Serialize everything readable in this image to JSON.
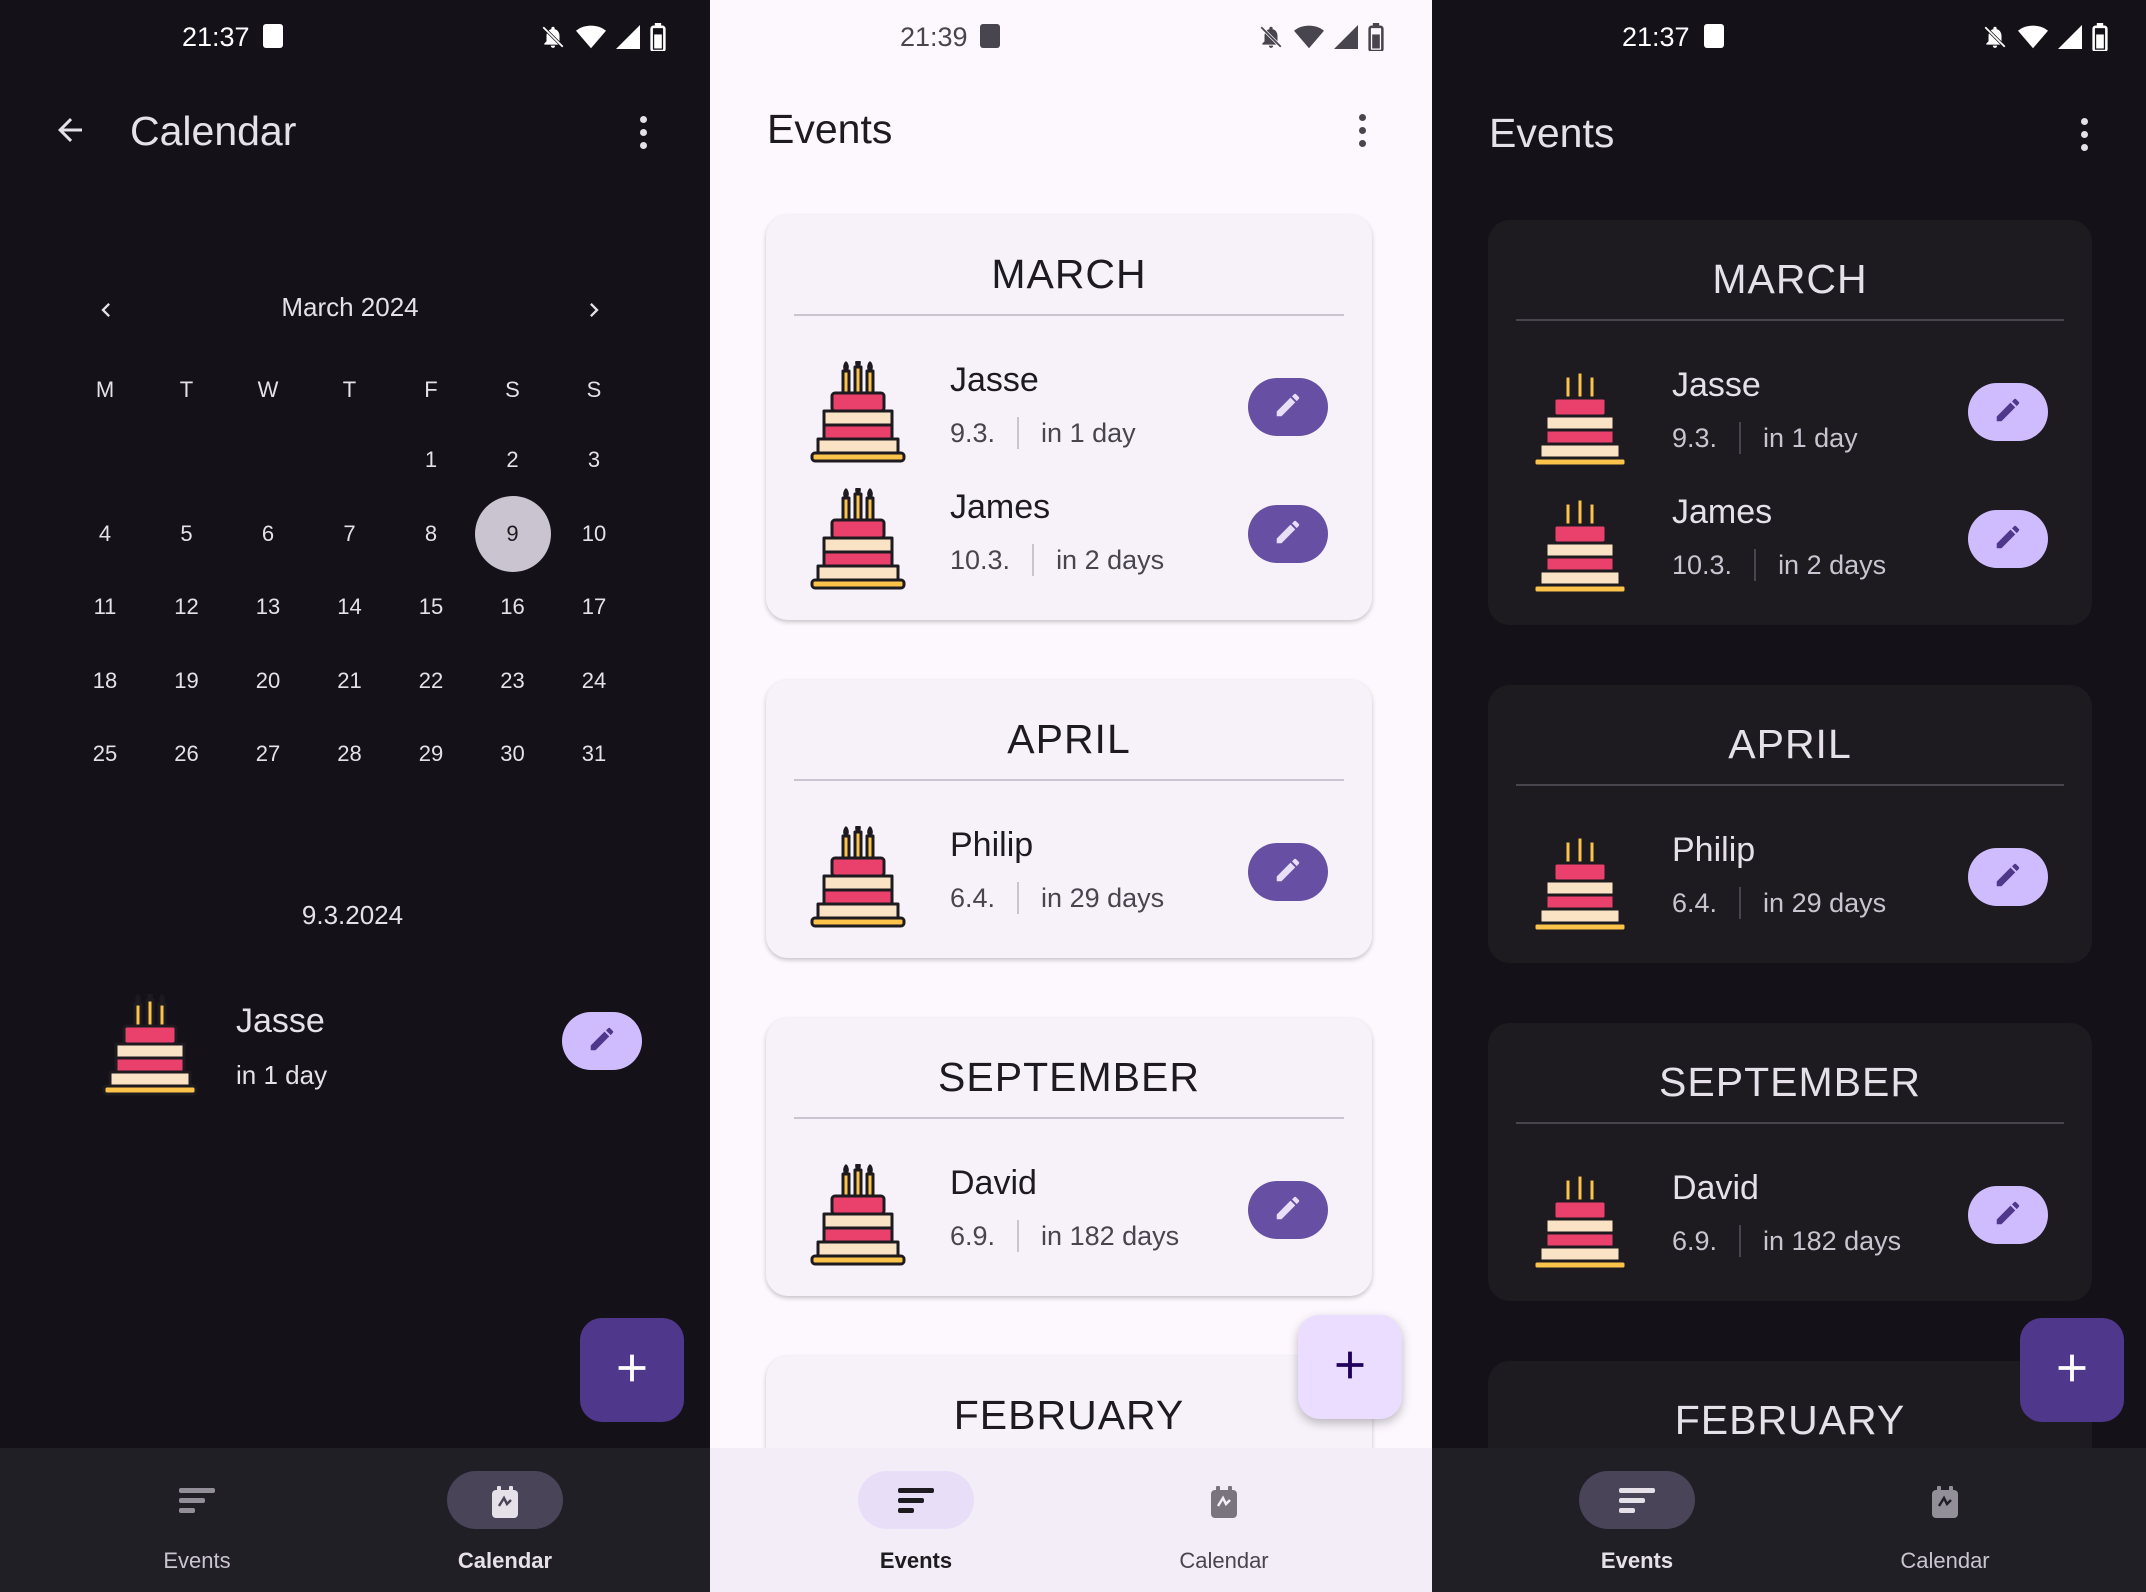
{
  "cake_icon": "birthday-cake-icon",
  "pencil_icon": "pencil-icon",
  "plus_icon": "plus-icon",
  "screens": {
    "calendar": {
      "status_time": "21:37",
      "title": "Calendar",
      "month_label": "March 2024",
      "weekdays": [
        "M",
        "T",
        "W",
        "T",
        "F",
        "S",
        "S"
      ],
      "first_weekday_index": 4,
      "days_in_month": 31,
      "selected_day": "9",
      "selected_date": "9.3.2024",
      "event": {
        "name": "Jasse",
        "relative": "in 1 day"
      },
      "nav": {
        "events": "Events",
        "calendar": "Calendar",
        "active": "calendar"
      }
    },
    "events_light": {
      "status_time": "21:39",
      "title": "Events",
      "nav": {
        "events": "Events",
        "calendar": "Calendar",
        "active": "events"
      }
    },
    "events_dark": {
      "status_time": "21:37",
      "title": "Events",
      "nav": {
        "events": "Events",
        "calendar": "Calendar",
        "active": "events"
      }
    }
  },
  "months": [
    {
      "name": "MARCH",
      "events": [
        {
          "name": "Jasse",
          "date": "9.3.",
          "relative": "in 1 day"
        },
        {
          "name": "James",
          "date": "10.3.",
          "relative": "in 2 days"
        }
      ]
    },
    {
      "name": "APRIL",
      "events": [
        {
          "name": "Philip",
          "date": "6.4.",
          "relative": "in 29 days"
        }
      ]
    },
    {
      "name": "SEPTEMBER",
      "events": [
        {
          "name": "David",
          "date": "6.9.",
          "relative": "in 182 days"
        }
      ]
    },
    {
      "name": "FEBRUARY",
      "events": []
    }
  ],
  "colors": {
    "dark_bg": "#141218",
    "light_bg": "#fdf7fe",
    "accent_dark": "#cfbcff",
    "accent_light": "#6750a4",
    "fab_dark": "#4f378b",
    "fab_light": "#eaddff"
  }
}
